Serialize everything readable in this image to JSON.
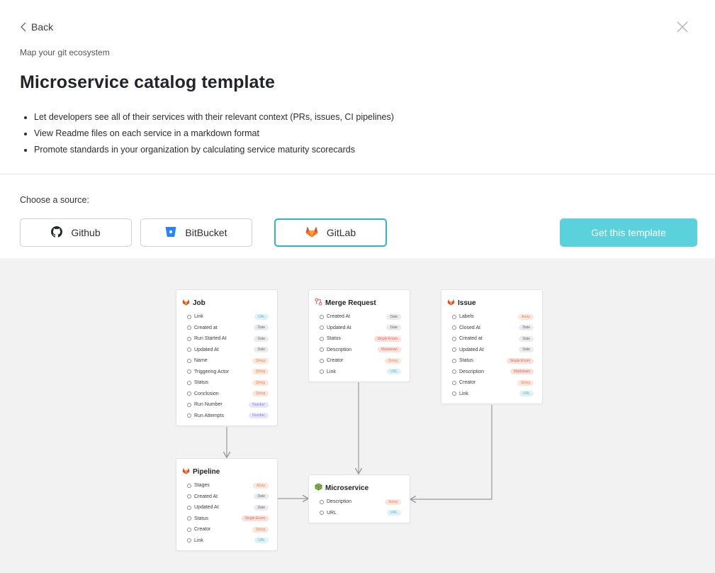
{
  "nav": {
    "back_label": "Back"
  },
  "header": {
    "eyebrow": "Map your git ecosystem",
    "title": "Microservice catalog template",
    "bullets": [
      "Let developers see all of their services with their relevant context (PRs, issues, CI pipelines)",
      "View Readme files on each service in a markdown format",
      "Promote standards in your organization by calculating service maturity scorecards"
    ]
  },
  "source": {
    "prompt": "Choose a source:",
    "options": [
      {
        "label": "Github",
        "icon": "github-icon",
        "selected": false
      },
      {
        "label": "BitBucket",
        "icon": "bitbucket-icon",
        "selected": false
      },
      {
        "label": "GitLab",
        "icon": "gitlab-icon",
        "selected": true
      }
    ],
    "cta_label": "Get this template"
  },
  "colors": {
    "accent": "#5bd1dc",
    "accent_border": "#2cb7c5",
    "gitlab": "#e24329",
    "canvas": "#f2f2f3"
  },
  "diagram": {
    "job": {
      "title": "Job",
      "icon": "gitlab-icon",
      "props": [
        {
          "name": "Link",
          "type": "URL"
        },
        {
          "name": "Created at",
          "type": "Date"
        },
        {
          "name": "Run Started At",
          "type": "Date"
        },
        {
          "name": "Updated At",
          "type": "Date"
        },
        {
          "name": "Name",
          "type": "String"
        },
        {
          "name": "Triggering Actor",
          "type": "String"
        },
        {
          "name": "Status",
          "type": "String"
        },
        {
          "name": "Conclusion",
          "type": "String"
        },
        {
          "name": "Run Number",
          "type": "Number"
        },
        {
          "name": "Run Attempts",
          "type": "Number"
        }
      ]
    },
    "merge_request": {
      "title": "Merge Request",
      "icon": "merge-request-icon",
      "props": [
        {
          "name": "Created At",
          "type": "Date"
        },
        {
          "name": "Updated At",
          "type": "Date"
        },
        {
          "name": "Status",
          "type": "Single Enum"
        },
        {
          "name": "Description",
          "type": "Markdown"
        },
        {
          "name": "Creator",
          "type": "String"
        },
        {
          "name": "Link",
          "type": "URL"
        }
      ]
    },
    "issue": {
      "title": "Issue",
      "icon": "gitlab-icon",
      "props": [
        {
          "name": "Labels",
          "type": "Array"
        },
        {
          "name": "Closed At",
          "type": "Date"
        },
        {
          "name": "Created at",
          "type": "Date"
        },
        {
          "name": "Updated At",
          "type": "Date"
        },
        {
          "name": "Status",
          "type": "Single Enum"
        },
        {
          "name": "Description",
          "type": "Markdown"
        },
        {
          "name": "Creator",
          "type": "String"
        },
        {
          "name": "Link",
          "type": "URL"
        }
      ]
    },
    "pipeline": {
      "title": "Pipeline",
      "icon": "gitlab-icon",
      "props": [
        {
          "name": "Stages",
          "type": "Array"
        },
        {
          "name": "Created At",
          "type": "Date"
        },
        {
          "name": "Updated At",
          "type": "Date"
        },
        {
          "name": "Status",
          "type": "Single Enum"
        },
        {
          "name": "Creator",
          "type": "String"
        },
        {
          "name": "Link",
          "type": "URL"
        }
      ]
    },
    "microservice": {
      "title": "Microservice",
      "icon": "cube-icon",
      "props": [
        {
          "name": "Description",
          "type": "String"
        },
        {
          "name": "URL",
          "type": "URL"
        }
      ]
    }
  }
}
